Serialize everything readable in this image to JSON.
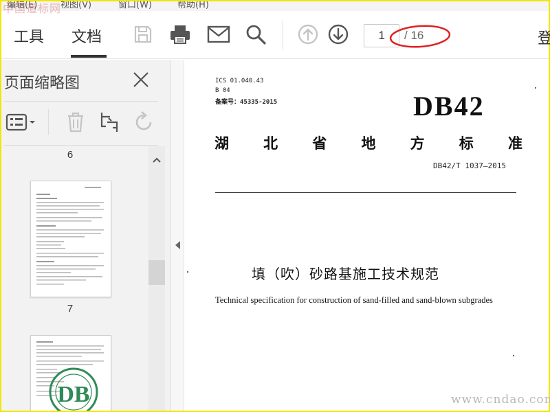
{
  "watermark_top": "中国道标网",
  "menubar": {
    "items": [
      "编辑(E)",
      "视图(V)",
      "窗口(W)",
      "帮助(H)"
    ]
  },
  "toolbar": {
    "tabs": [
      {
        "label": "工具"
      },
      {
        "label": "文档",
        "active": true
      }
    ],
    "page_current": "1",
    "page_total": "/ 16",
    "right_clipped": "登"
  },
  "sidebar": {
    "title": "页面缩略图",
    "thumbnails": [
      {
        "page": "6"
      },
      {
        "page": "7"
      }
    ]
  },
  "document": {
    "ics": "ICS 01.040.43",
    "b_code": "B 04",
    "filing": "备案号：45335-2015",
    "db_code": "DB42",
    "province_chars": [
      "湖",
      "北",
      "省",
      "地",
      "方",
      "标",
      "准"
    ],
    "std_number": "DB42/T 1037—2015",
    "title_cn": "填（吹）砂路基施工技术规范",
    "title_en": "Technical specification for construction of sand-filled and sand-blown subgrades"
  },
  "watermark_bottom": "www.cndao.com",
  "colors": {
    "frame": "#f2e600",
    "annotation_red": "#e02020"
  }
}
